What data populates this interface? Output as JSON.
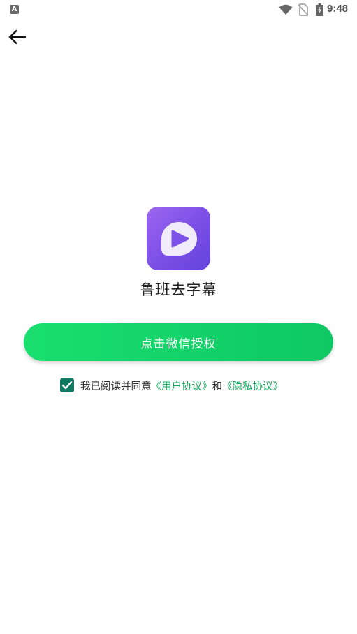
{
  "status_bar": {
    "time": "9:48",
    "notification_icon": "text-notification-icon",
    "wifi_icon": "wifi-icon",
    "sim_icon": "no-sim-icon",
    "battery_icon": "battery-charging-icon"
  },
  "header": {
    "back_icon": "arrow-left-icon"
  },
  "app": {
    "name": "鲁班去字幕",
    "logo_icon": "play-logo-icon",
    "logo_colors": [
      "#9d66f0",
      "#6343dc"
    ]
  },
  "auth": {
    "button_label": "点击微信授权",
    "button_color": "#12d468"
  },
  "agreement": {
    "checked": true,
    "prefix": "我已阅读并同意",
    "user_agreement": "《用户协议》",
    "conjunction": "和",
    "privacy_policy": "《隐私协议》",
    "link_color": "#15a85c",
    "checkbox_color": "#117a63"
  }
}
